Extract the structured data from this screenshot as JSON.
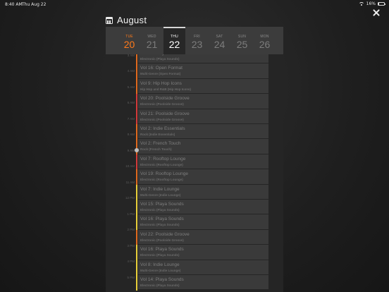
{
  "status_bar": {
    "time": "8:40 AM",
    "date": "Thu Aug 22",
    "battery": "16%",
    "battery_level": 0.16
  },
  "header": {
    "month": "August"
  },
  "days": [
    {
      "name": "TUE",
      "number": "20",
      "state": "today"
    },
    {
      "name": "WED",
      "number": "21",
      "state": "normal"
    },
    {
      "name": "THU",
      "number": "22",
      "state": "selected"
    },
    {
      "name": "FRI",
      "number": "23",
      "state": "normal"
    },
    {
      "name": "SAT",
      "number": "24",
      "state": "normal"
    },
    {
      "name": "SUN",
      "number": "25",
      "state": "normal"
    },
    {
      "name": "MON",
      "number": "26",
      "state": "normal"
    }
  ],
  "times": [
    "3 AM",
    "4 AM",
    "5 AM",
    "6 AM",
    "7 AM",
    "8 AM",
    "9 AM",
    "10 AM",
    "11 AM",
    "12 PM",
    "1 PM",
    "2 PM",
    "3 PM",
    "4 PM",
    "5 PM"
  ],
  "shows": [
    {
      "title": "Vol 21: Playa Sounds",
      "subtitle": "Electronic (Playa Sounds)",
      "color": "#e06a1e"
    },
    {
      "title": "Vol 16: Open Format",
      "subtitle": "Multi-Genre (Open Format)",
      "color": "#e06a1e"
    },
    {
      "title": "Vol 9: Hip Hop Icons",
      "subtitle": "Hip Hop and R&B (Hip Hop Icons)",
      "color": "#e06a1e"
    },
    {
      "title": "Vol 20: Poolside Groove",
      "subtitle": "Electronic (Poolside Groove)",
      "color": "#d33a3a"
    },
    {
      "title": "Vol 21: Poolside Groove",
      "subtitle": "Electronic (Poolside Groove)",
      "color": "#d33a3a"
    },
    {
      "title": "Vol 2: Indie Essentials",
      "subtitle": "Rock (Indie Essentials)",
      "color": "#e06a1e"
    },
    {
      "title": "Vol 2: French Touch",
      "subtitle": "Rock (French Touch)",
      "color": "#e06a1e"
    },
    {
      "title": "Vol 7: Rooftop Lounge",
      "subtitle": "Electronic (Rooftop Lounge)",
      "color": "#d33a3a"
    },
    {
      "title": "Vol 19: Rooftop Lounge",
      "subtitle": "Electronic (Rooftop Lounge)",
      "color": "#e06a1e"
    },
    {
      "title": "Vol 7: Indie Lounge",
      "subtitle": "Multi-Genre (Indie Lounge)",
      "color": "#e8cf3a"
    },
    {
      "title": "Vol 15: Playa Sounds",
      "subtitle": "Electronic (Playa Sounds)",
      "color": "#e8cf3a"
    },
    {
      "title": "Vol 16: Playa Sounds",
      "subtitle": "Electronic (Playa Sounds)",
      "color": "#e8cf3a"
    },
    {
      "title": "Vol 22: Poolside Groove",
      "subtitle": "Electronic (Poolside Groove)",
      "color": "#e06a1e"
    },
    {
      "title": "Vol 16: Playa Sounds",
      "subtitle": "Electronic (Playa Sounds)",
      "color": "#e8cf3a"
    },
    {
      "title": "Vol 8: Indie Lounge",
      "subtitle": "Multi-Genre (Indie Lounge)",
      "color": "#e8cf3a"
    },
    {
      "title": "Vol 14: Playa Sounds",
      "subtitle": "Electronic (Playa Sounds)",
      "color": "#e8cf3a"
    }
  ],
  "now_marker_slot": 6
}
